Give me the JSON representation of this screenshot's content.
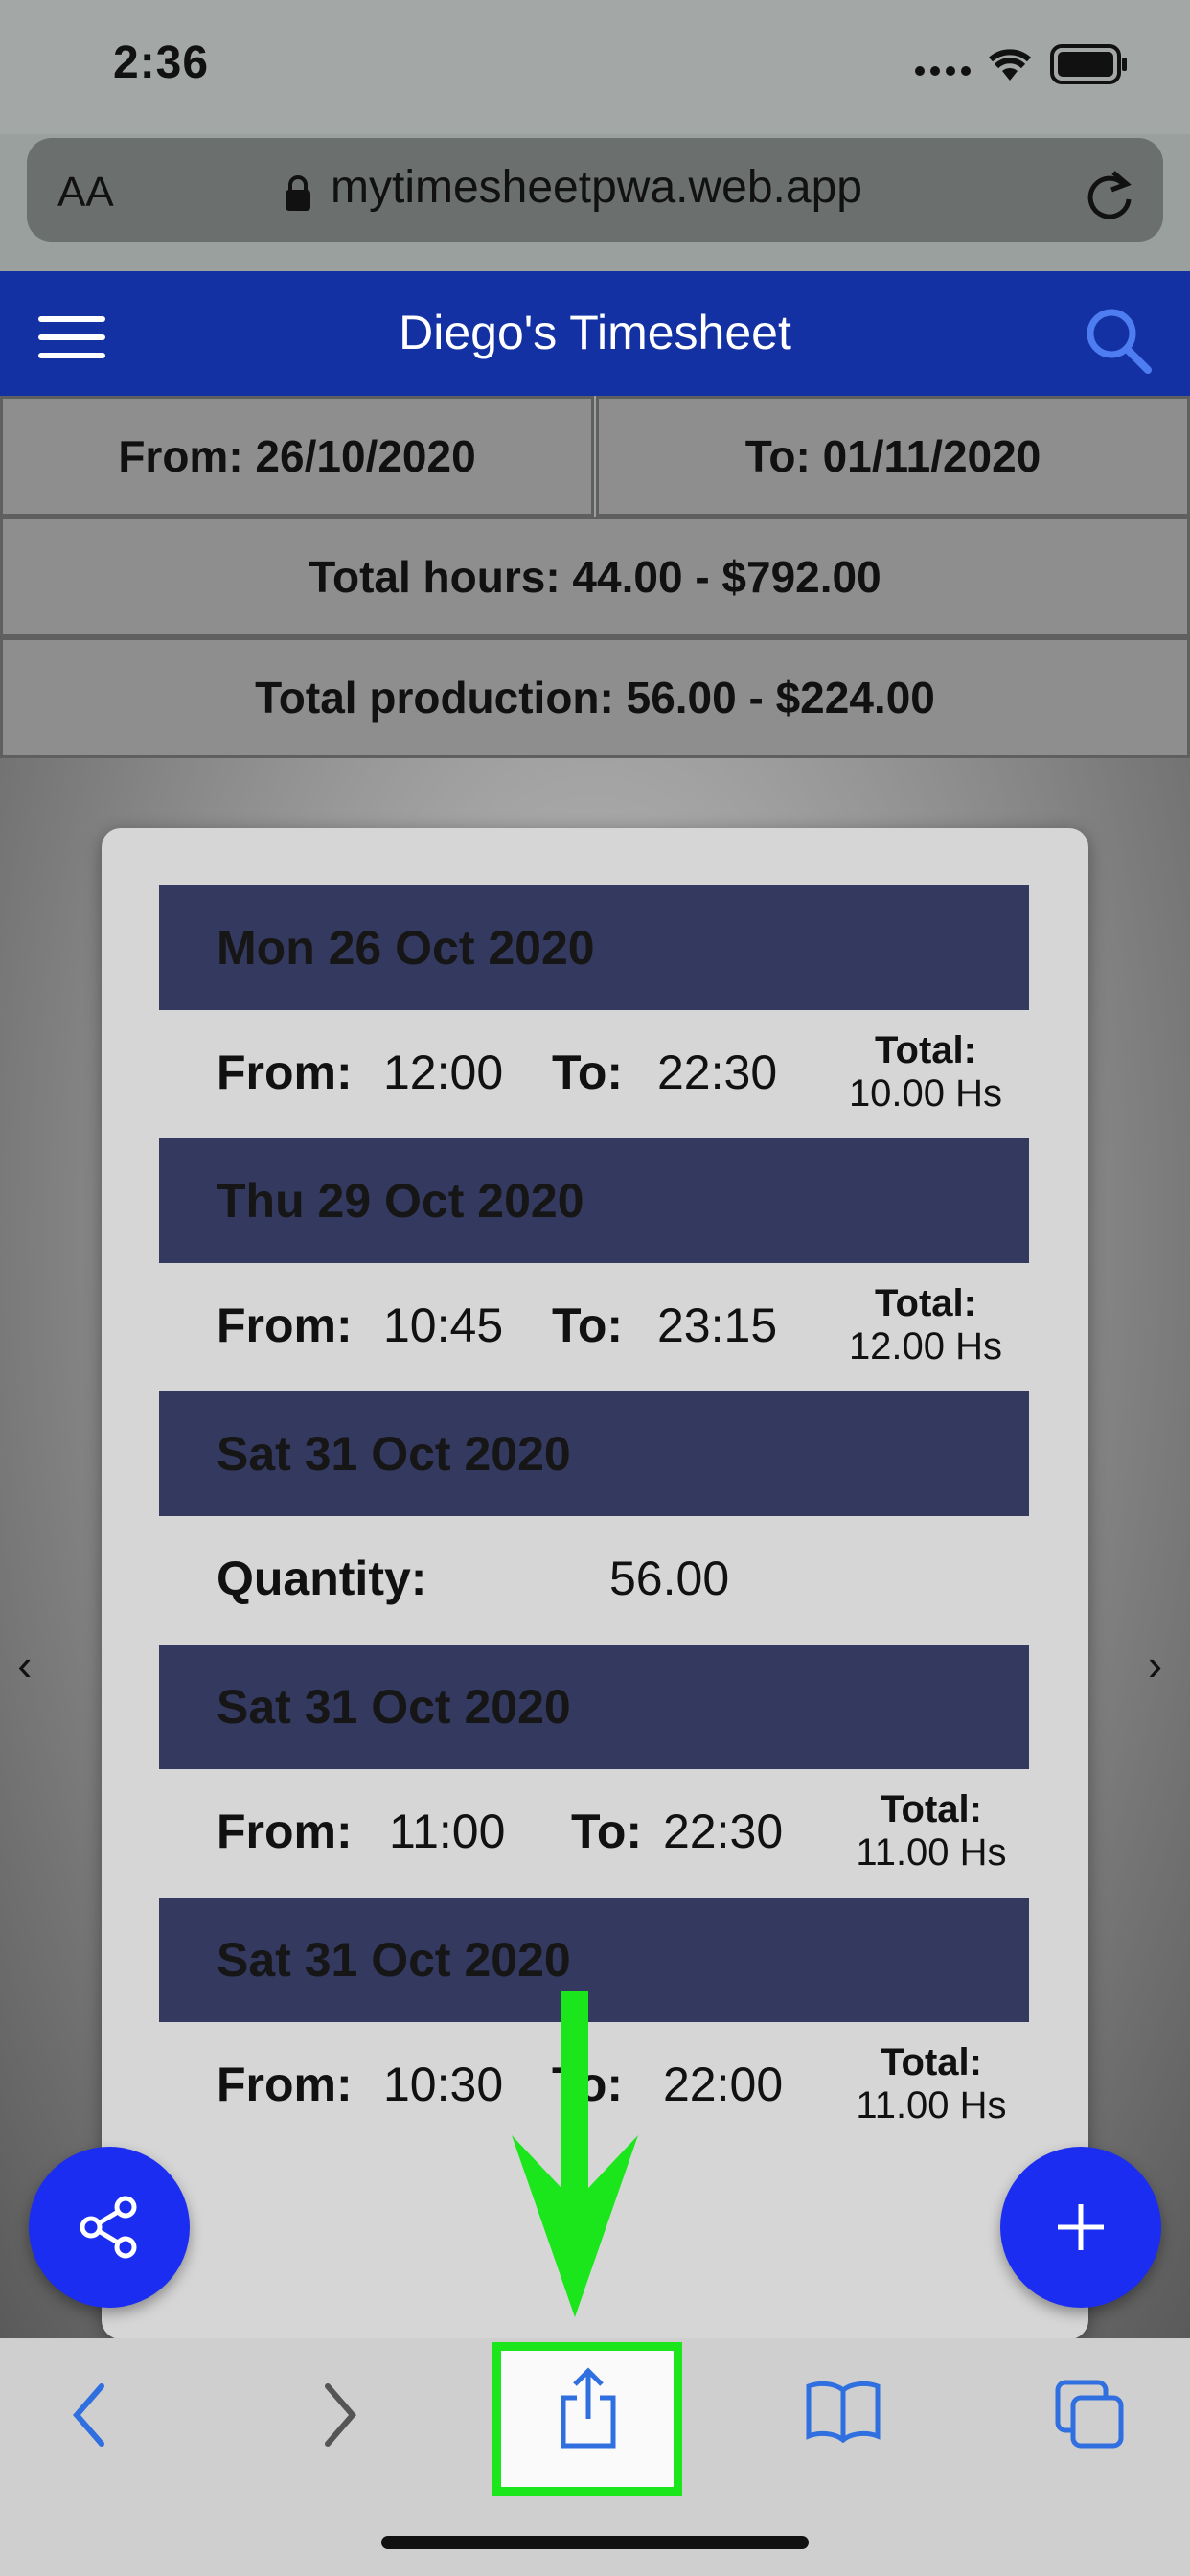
{
  "status_bar": {
    "time": "2:36"
  },
  "browser": {
    "text_size_label": "AA",
    "url": "mytimesheetpwa.web.app"
  },
  "header": {
    "title": "Diego's Timesheet"
  },
  "summary": {
    "from": "From: 26/10/2020",
    "to": "To: 01/11/2020",
    "total_hours": "Total hours: 44.00 - $792.00",
    "total_production": "Total production: 56.00 - $224.00"
  },
  "entries": [
    {
      "date": "Mon 26 Oct 2020",
      "from_label": "From:",
      "from": "12:00",
      "to_label": "To:",
      "to": "22:30",
      "total_label": "Total:",
      "total": "10.00 Hs"
    },
    {
      "date": "Thu 29 Oct 2020",
      "from_label": "From:",
      "from": "10:45",
      "to_label": "To:",
      "to": "23:15",
      "total_label": "Total:",
      "total": "12.00 Hs"
    },
    {
      "date": "Sat 31 Oct 2020",
      "quantity_label": "Quantity:",
      "quantity": "56.00"
    },
    {
      "date": "Sat 31 Oct 2020",
      "from_label": "From:",
      "from": "11:00",
      "to_label": "To:",
      "to": "22:30",
      "total_label": "Total:",
      "total": "11.00 Hs"
    },
    {
      "date": "Sat 31 Oct 2020",
      "from_label": "From:",
      "from": "10:30",
      "to_label": "To:",
      "to": "22:00",
      "total_label": "Total:",
      "total": "11.00 Hs"
    }
  ],
  "carousel": {
    "prev": "‹",
    "next": "›"
  },
  "colors": {
    "app_bar": "#1431a3",
    "day_header": "#34395f",
    "fab": "#1a2df0",
    "highlight": "#1be51b",
    "toolbar_icon": "#2f6fe0"
  },
  "icons": {
    "menu": "hamburger-icon",
    "search": "search-icon",
    "share_fab": "share-nodes-icon",
    "add_fab": "plus-icon",
    "back": "chevron-left-icon",
    "forward": "chevron-right-icon",
    "share": "share-icon",
    "bookmarks": "book-icon",
    "tabs": "tabs-icon"
  }
}
